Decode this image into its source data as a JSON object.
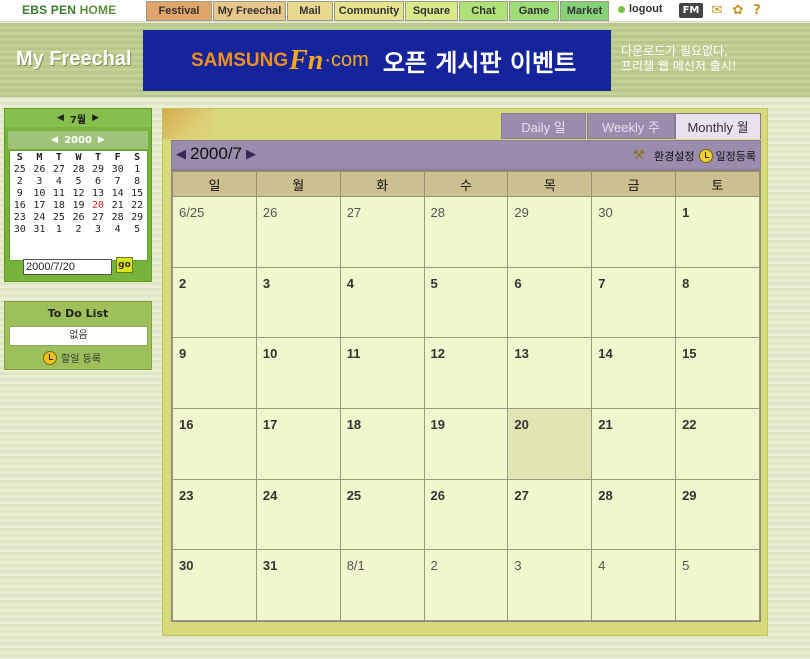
{
  "topnav": {
    "logo_main": "EBS PEN",
    "logo_home": "HOME",
    "tabs": [
      "Festival",
      "My Freechal",
      "Mail",
      "Community",
      "Square",
      "Chat",
      "Game",
      "Market"
    ],
    "logout": "logout",
    "fm_label": "FM"
  },
  "header": {
    "site_title": "My Freechal",
    "banner": {
      "part1": "SAMSUNG",
      "part2": "Fn",
      "part3": "·com",
      "part4": "오픈 게시판 이벤트"
    },
    "promo_line1": "다운로드가 필요없다,",
    "promo_line2": "프리챌 웹 메신저 출시!"
  },
  "minical": {
    "month": "7월",
    "year": "2000",
    "weekdays": [
      "S",
      "M",
      "T",
      "W",
      "T",
      "F",
      "S"
    ],
    "weeks": [
      [
        "25",
        "26",
        "27",
        "28",
        "29",
        "30",
        "1"
      ],
      [
        "2",
        "3",
        "4",
        "5",
        "6",
        "7",
        "8"
      ],
      [
        "9",
        "10",
        "11",
        "12",
        "13",
        "14",
        "15"
      ],
      [
        "16",
        "17",
        "18",
        "19",
        "20",
        "21",
        "22"
      ],
      [
        "23",
        "24",
        "25",
        "26",
        "27",
        "28",
        "29"
      ],
      [
        "30",
        "31",
        "1",
        "2",
        "3",
        "4",
        "5"
      ]
    ],
    "highlight": "20",
    "highlight_color": "#d02020",
    "date_value": "2000/7/20",
    "go_label": "go"
  },
  "todo": {
    "title": "To Do List",
    "empty": "없음",
    "add_label": "할일 등록"
  },
  "calendar": {
    "tabs": {
      "daily": "Daily 일",
      "weekly": "Weekly 주",
      "monthly": "Monthly 월"
    },
    "title": "2000/7",
    "settings_label": "환경설정",
    "add_schedule_label": "일정등록",
    "weekday_headers": [
      "일",
      "월",
      "화",
      "수",
      "목",
      "금",
      "토"
    ],
    "weeks": [
      [
        {
          "d": "6/25",
          "o": 1
        },
        {
          "d": "26",
          "o": 1
        },
        {
          "d": "27",
          "o": 1
        },
        {
          "d": "28",
          "o": 1
        },
        {
          "d": "29",
          "o": 1
        },
        {
          "d": "30",
          "o": 1
        },
        {
          "d": "1",
          "o": 0
        }
      ],
      [
        {
          "d": "2",
          "o": 0
        },
        {
          "d": "3",
          "o": 0
        },
        {
          "d": "4",
          "o": 0
        },
        {
          "d": "5",
          "o": 0
        },
        {
          "d": "6",
          "o": 0
        },
        {
          "d": "7",
          "o": 0
        },
        {
          "d": "8",
          "o": 0
        }
      ],
      [
        {
          "d": "9",
          "o": 0
        },
        {
          "d": "10",
          "o": 0
        },
        {
          "d": "11",
          "o": 0
        },
        {
          "d": "12",
          "o": 0
        },
        {
          "d": "13",
          "o": 0
        },
        {
          "d": "14",
          "o": 0
        },
        {
          "d": "15",
          "o": 0
        }
      ],
      [
        {
          "d": "16",
          "o": 0
        },
        {
          "d": "17",
          "o": 0
        },
        {
          "d": "18",
          "o": 0
        },
        {
          "d": "19",
          "o": 0
        },
        {
          "d": "20",
          "o": 0,
          "today": 1
        },
        {
          "d": "21",
          "o": 0
        },
        {
          "d": "22",
          "o": 0
        }
      ],
      [
        {
          "d": "23",
          "o": 0
        },
        {
          "d": "24",
          "o": 0
        },
        {
          "d": "25",
          "o": 0
        },
        {
          "d": "26",
          "o": 0
        },
        {
          "d": "27",
          "o": 0
        },
        {
          "d": "28",
          "o": 0
        },
        {
          "d": "29",
          "o": 0
        }
      ],
      [
        {
          "d": "30",
          "o": 0
        },
        {
          "d": "31",
          "o": 0
        },
        {
          "d": "8/1",
          "o": 1
        },
        {
          "d": "2",
          "o": 1
        },
        {
          "d": "3",
          "o": 1
        },
        {
          "d": "4",
          "o": 1
        },
        {
          "d": "5",
          "o": 1
        }
      ]
    ]
  }
}
